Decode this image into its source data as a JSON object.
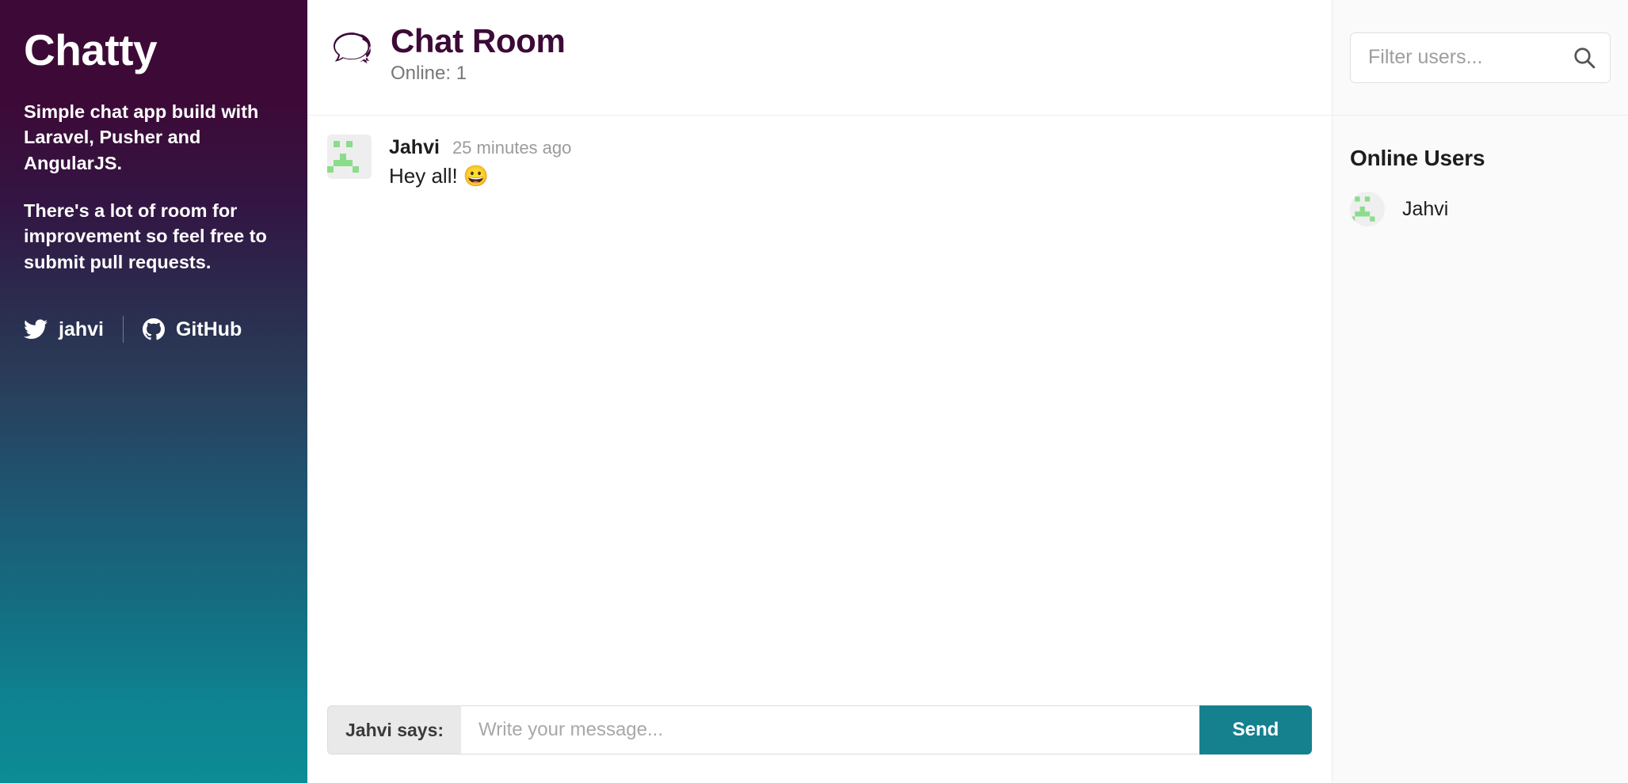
{
  "sidebar": {
    "brand_title": "Chatty",
    "paragraphs": [
      "Simple chat app build with Laravel, Pusher and AngularJS.",
      "There's a lot of room for improvement so feel free to submit pull requests."
    ],
    "social": [
      {
        "icon": "twitter-icon",
        "label": "jahvi"
      },
      {
        "icon": "github-icon",
        "label": "GitHub"
      }
    ],
    "gradient_top_color": "#3d0a37",
    "gradient_bottom_color": "#0c8c95"
  },
  "chat": {
    "icon": "speech-bubbles-icon",
    "title": "Chat Room",
    "subtitle": "Online: 1",
    "title_color": "#3d0a37",
    "messages": [
      {
        "author": "Jahvi",
        "time": "25 minutes ago",
        "text": "Hey all! 😀",
        "avatar": "identicon-avatar"
      }
    ],
    "composer": {
      "prefix": "Jahvi says:",
      "placeholder": "Write your message...",
      "value": "",
      "send_label": "Send",
      "send_color": "#15818f"
    }
  },
  "users_panel": {
    "filter": {
      "placeholder": "Filter users...",
      "value": "",
      "icon": "search-icon"
    },
    "heading": "Online Users",
    "users": [
      {
        "name": "Jahvi",
        "avatar": "identicon-avatar"
      }
    ]
  }
}
